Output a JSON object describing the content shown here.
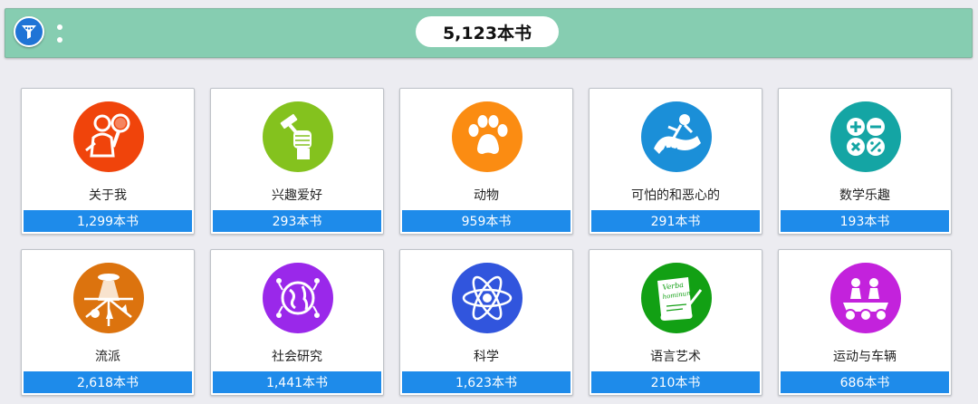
{
  "header": {
    "total_count": "5,123本书",
    "filter_icon": "filter-icon",
    "menu_icon": "more-vertical-icon"
  },
  "categories": [
    {
      "title": "关于我",
      "count": "1,299本书",
      "icon": "person-magnifier-icon",
      "color": "#f0440b"
    },
    {
      "title": "兴趣爱好",
      "count": "293本书",
      "icon": "hammer-fist-icon",
      "color": "#84c21e"
    },
    {
      "title": "动物",
      "count": "959本书",
      "icon": "paw-icon",
      "color": "#fb8c12"
    },
    {
      "title": "可怕的和恶心的",
      "count": "291本书",
      "icon": "monster-icon",
      "color": "#1b8fd8"
    },
    {
      "title": "数学乐趣",
      "count": "193本书",
      "icon": "math-operators-icon",
      "color": "#14a5a4"
    },
    {
      "title": "流派",
      "count": "2,618本书",
      "icon": "genre-collage-icon",
      "color": "#dc730e"
    },
    {
      "title": "社会研究",
      "count": "1,441本书",
      "icon": "globe-people-icon",
      "color": "#9a28ea"
    },
    {
      "title": "科学",
      "count": "1,623本书",
      "icon": "atom-icon",
      "color": "#3155dd"
    },
    {
      "title": "语言艺术",
      "count": "210本书",
      "icon": "scroll-quill-icon",
      "color": "#12a014"
    },
    {
      "title": "运动与车辆",
      "count": "686本书",
      "icon": "vehicle-riders-icon",
      "color": "#c322dc"
    }
  ],
  "icon_texts": {
    "scroll_line1": "Verba",
    "scroll_line2": "hominum"
  }
}
